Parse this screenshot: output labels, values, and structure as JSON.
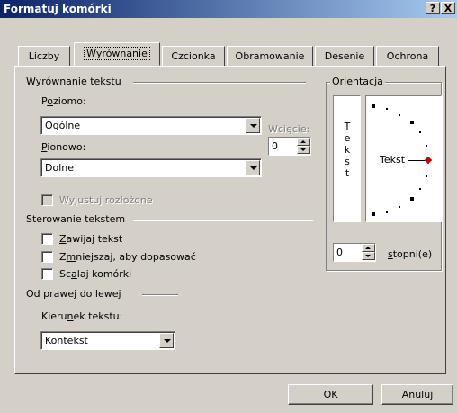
{
  "window": {
    "title": "Formatuj komórki",
    "help_btn": "?",
    "close_btn": "X"
  },
  "tabs": [
    "Liczby",
    "Wyrównanie",
    "Czcionka",
    "Obramowanie",
    "Desenie",
    "Ochrona"
  ],
  "active_tab": "Wyrównanie",
  "alignment": {
    "section_title": "Wyrównanie tekstu",
    "horizontal": {
      "label_pre": "P",
      "label_u": "o",
      "label_post": "ziomo:",
      "value": "Ogólne"
    },
    "indent": {
      "label": "Wcięcie:",
      "value": "0"
    },
    "vertical": {
      "label_u": "P",
      "label_post": "ionowo:",
      "value": "Dolne"
    },
    "justify_distributed": {
      "label": "Wyjustuj rozłożone",
      "checked": false,
      "enabled": false
    }
  },
  "text_control": {
    "section_title": "Sterowanie tekstem",
    "wrap": {
      "label_u": "Z",
      "label_post": "awijaj tekst",
      "checked": false
    },
    "shrink": {
      "label_pre": "Z",
      "label_u": "m",
      "label_post": "niejszaj, aby dopasować",
      "checked": false
    },
    "merge": {
      "label_pre": "Sc",
      "label_u": "a",
      "label_post": "laj komórki",
      "checked": false
    }
  },
  "rtl": {
    "section_title": "Od prawej do lewej",
    "direction": {
      "label_pre": "Kieru",
      "label_u": "n",
      "label_post": "ek tekstu:",
      "value": "Kontekst"
    }
  },
  "orientation": {
    "section_title": "Orientacja",
    "vertical_text_letters": [
      "T",
      "e",
      "k",
      "s",
      "t"
    ],
    "dial_text": "Tekst",
    "degrees": {
      "value": "0",
      "label_u": "s",
      "label_post": "topni(e)"
    },
    "marker_color": "#cc0000"
  },
  "buttons": {
    "ok": "OK",
    "cancel": "Anuluj"
  }
}
